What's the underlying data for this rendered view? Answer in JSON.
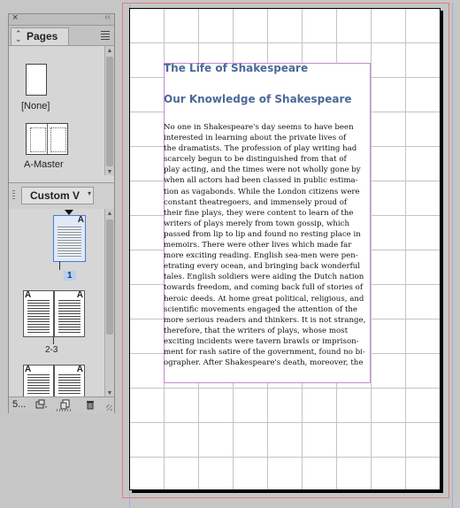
{
  "panel": {
    "close_glyph": "×",
    "collapse_glyph": "‹‹",
    "tab_label": "Pages",
    "tab_updown_glyph": "⌃⌄",
    "menu_icon": "panel-menu-icon",
    "masters": [
      {
        "label": "[None]"
      },
      {
        "label": "A-Master"
      }
    ],
    "view_select": {
      "label": "Custom V",
      "arrow": "▾"
    },
    "pages": [
      {
        "number": "1",
        "master_letter": "A",
        "selected": true
      },
      {
        "number": "2-3",
        "master_letter_left": "A",
        "master_letter_right": "A"
      }
    ],
    "bottom_bar": {
      "page_count": "5...",
      "icons": [
        "edit-page-size-icon",
        "new-page-icon",
        "delete-page-icon"
      ]
    }
  },
  "document": {
    "title": "The Life of Shakespeare",
    "subtitle": "Our Knowledge of Shakespeare",
    "body_lines": [
      "No one in Shakespeare's day seems to have been",
      "interested in learning about the private lives of",
      "the dramatists. The profession of play writing had",
      "scarcely begun to be distinguished from that of",
      "play acting, and the times were not wholly gone by",
      "when all actors had been classed in public estima-",
      "tion as vagabonds. While the London citizens were",
      "constant theatregoers, and immensely proud of",
      "their fine plays, they were content to learn of the",
      "writers of plays merely from town gossip, which",
      "passed from lip to lip and found no resting place in",
      "memoirs. There were other lives which made far",
      "more exciting reading. English sea-men were pen-",
      "etrating every ocean, and bringing back wonderful",
      "tales. English soldiers were aiding the Dutch nation",
      "towards freedom, and coming back full of stories of",
      "heroic deeds. At home great political, religious, and",
      "scientific movements engaged the attention of the",
      "more serious readers and thinkers. It is not strange,",
      "therefore, that the writers of plays, whose most",
      "exciting incidents were tavern brawls or imprison-",
      "ment for rash satire of the government, found no bi-",
      "ographer. After Shakespeare's death, moreover, the"
    ]
  },
  "colors": {
    "heading": "#4a6a9a",
    "frame_edge": "#c788d4",
    "bleed_guide": "#d98080",
    "grid": "#c4c4c4",
    "selected_page": "#b8cff0"
  }
}
